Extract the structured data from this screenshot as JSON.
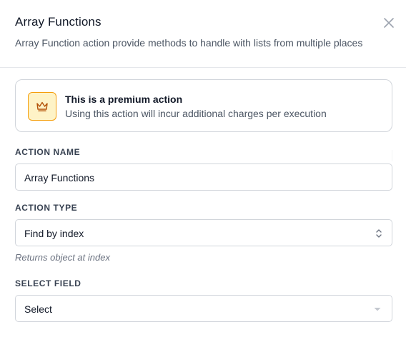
{
  "dialog": {
    "title": "Array Functions",
    "subtitle": "Array Function action provide methods to handle with lists from multiple places",
    "close_icon": "close-icon"
  },
  "premium": {
    "icon": "crown-icon",
    "title": "This is a premium action",
    "description": "Using this action will incur additional charges per execution",
    "accent_color": "#f59e0b"
  },
  "action_name": {
    "label": "ACTION NAME",
    "value": "Array Functions"
  },
  "action_type": {
    "label": "ACTION TYPE",
    "value": "Find by index",
    "hint": "Returns object at index",
    "icon": "chevron-up-down-icon"
  },
  "select_field": {
    "label": "SELECT FIELD",
    "placeholder": "Select",
    "icon": "caret-down-icon"
  }
}
